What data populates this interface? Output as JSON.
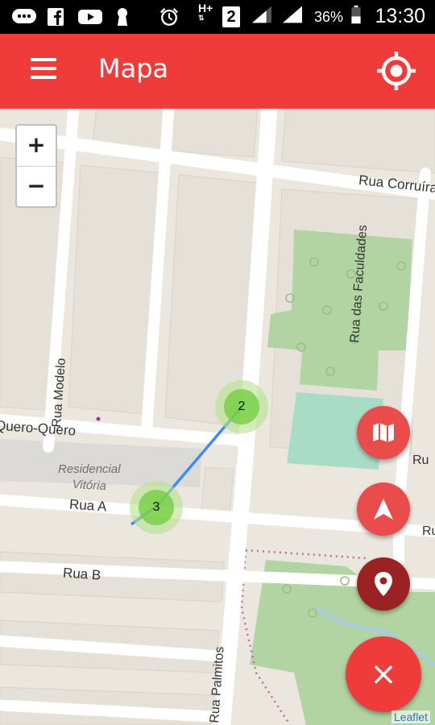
{
  "status_bar": {
    "icons": [
      "chat-icon",
      "facebook-icon",
      "youtube-icon",
      "keyhole-icon",
      "alarm-icon",
      "hplus-signal-icon",
      "sim2-icon",
      "signal-icon",
      "signal-icon",
      "battery-icon"
    ],
    "network_label": "H+",
    "sim_label": "2",
    "battery": "36%",
    "time": "13:30"
  },
  "app_bar": {
    "title": "Mapa",
    "menu_icon": "hamburger-menu-icon",
    "locate_icon": "gps-target-icon",
    "color": "#f03b3b"
  },
  "map": {
    "zoom_in_label": "+",
    "zoom_out_label": "−",
    "streets": {
      "corruira": "Rua Corruíra",
      "faculdades": "Rua das Faculdades",
      "modelo": "Rua Modelo",
      "quero_quero": "Quero-Quero",
      "rua_a": "Rua A",
      "rua_b": "Rua B",
      "palmitos": "Rua Palmitos",
      "ru_1": "Ru",
      "ru_2": "Ru"
    },
    "area_label_line1": "Residencial",
    "area_label_line2": "Vitória",
    "clusters": [
      {
        "count": "2"
      },
      {
        "count": "3"
      }
    ],
    "attribution": "Leaflet"
  },
  "fabs": {
    "map_icon": "map-icon",
    "navigate_icon": "navigation-arrow-icon",
    "place_icon": "place-marker-icon",
    "close_icon": "close-icon",
    "close_label": "×"
  }
}
